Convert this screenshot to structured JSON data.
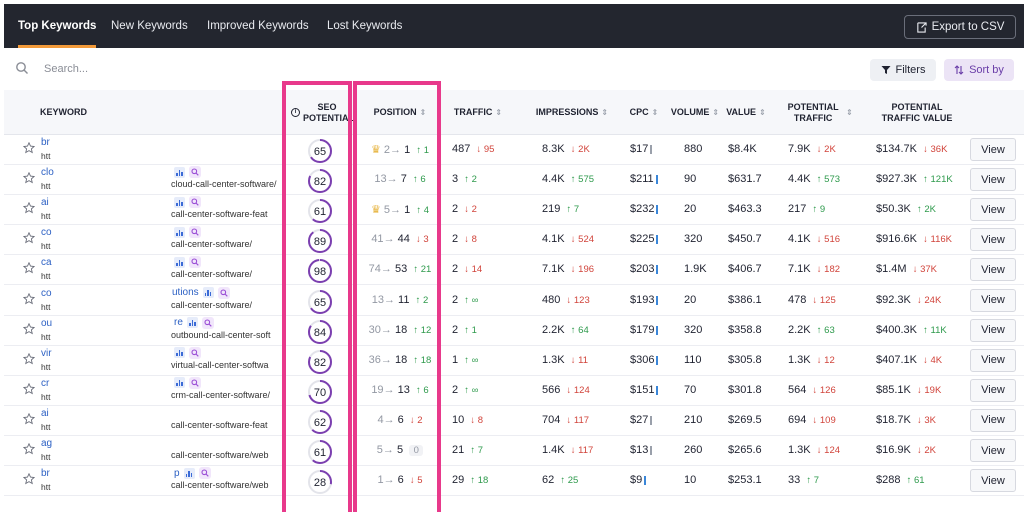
{
  "tabs": [
    {
      "label": "Top Keywords",
      "active": true
    },
    {
      "label": "New Keywords",
      "active": false
    },
    {
      "label": "Improved Keywords",
      "active": false
    },
    {
      "label": "Lost Keywords",
      "active": false
    }
  ],
  "export_label": "Export to CSV",
  "search": {
    "placeholder": "Search..."
  },
  "filters_label": "Filters",
  "sort_label": "Sort by",
  "columns": {
    "keyword": "KEYWORD",
    "seo_potential": "SEO POTENTIAL",
    "position": "POSITION",
    "traffic": "TRAFFIC",
    "impressions": "IMPRESSIONS",
    "cpc": "CPC",
    "volume": "VOLUME",
    "value": "VALUE",
    "potential_traffic": "POTENTIAL TRAFFIC",
    "potential_traffic_value": "POTENTIAL TRAFFIC VALUE"
  },
  "view_label": "View",
  "colors": {
    "highlight": "#e8398b",
    "accent_tab": "#f29a3a",
    "seo_ring": "#7b3fb0",
    "up": "#2e9a4c",
    "down": "#d1443b"
  },
  "rows": [
    {
      "kw": "br",
      "url": "htt",
      "badge_text": "",
      "badges": false,
      "landing": "",
      "seo": 65,
      "crown": true,
      "from": "2",
      "to": "1",
      "pdir": "up",
      "pchg": "1",
      "traffic": "487",
      "tdir": "dn",
      "tchg": "95",
      "impr": "8.3K",
      "idir": "dn",
      "ichg": "2K",
      "cpc": "$17",
      "cpc_color": "#9aa0ab",
      "volume": "880",
      "value": "$8.4K",
      "pt": "7.9K",
      "ptdir": "dn",
      "ptchg": "2K",
      "ptv": "$134.7K",
      "ptvdir": "dn",
      "ptvchg": "36K"
    },
    {
      "kw": "clo",
      "url": "htt",
      "badge_text": "",
      "badges": true,
      "landing": "cloud-call-center-software/",
      "seo": 82,
      "crown": false,
      "from": "13",
      "to": "7",
      "pdir": "up",
      "pchg": "6",
      "traffic": "3",
      "tdir": "up",
      "tchg": "2",
      "impr": "4.4K",
      "idir": "up",
      "ichg": "575",
      "cpc": "$211",
      "cpc_color": "#3a86d8",
      "volume": "90",
      "value": "$631.7",
      "pt": "4.4K",
      "ptdir": "up",
      "ptchg": "573",
      "ptv": "$927.3K",
      "ptvdir": "up",
      "ptvchg": "121K"
    },
    {
      "kw": "ai",
      "url": "htt",
      "badge_text": "",
      "badges": true,
      "landing": "call-center-software-feat",
      "seo": 61,
      "crown": true,
      "from": "5",
      "to": "1",
      "pdir": "up",
      "pchg": "4",
      "traffic": "2",
      "tdir": "dn",
      "tchg": "2",
      "impr": "219",
      "idir": "up",
      "ichg": "7",
      "cpc": "$232",
      "cpc_color": "#3a86d8",
      "volume": "20",
      "value": "$463.3",
      "pt": "217",
      "ptdir": "up",
      "ptchg": "9",
      "ptv": "$50.3K",
      "ptvdir": "up",
      "ptvchg": "2K"
    },
    {
      "kw": "co",
      "url": "htt",
      "badge_text": "",
      "badges": true,
      "landing": "call-center-software/",
      "seo": 89,
      "crown": false,
      "from": "41",
      "to": "44",
      "pdir": "dn",
      "pchg": "3",
      "traffic": "2",
      "tdir": "dn",
      "tchg": "8",
      "impr": "4.1K",
      "idir": "dn",
      "ichg": "524",
      "cpc": "$225",
      "cpc_color": "#3a86d8",
      "volume": "320",
      "value": "$450.7",
      "pt": "4.1K",
      "ptdir": "dn",
      "ptchg": "516",
      "ptv": "$916.6K",
      "ptvdir": "dn",
      "ptvchg": "116K"
    },
    {
      "kw": "ca",
      "url": "htt",
      "badge_text": "",
      "badges": true,
      "landing": "call-center-software/",
      "seo": 98,
      "crown": false,
      "from": "74",
      "to": "53",
      "pdir": "up",
      "pchg": "21",
      "traffic": "2",
      "tdir": "dn",
      "tchg": "14",
      "impr": "7.1K",
      "idir": "dn",
      "ichg": "196",
      "cpc": "$203",
      "cpc_color": "#3a86d8",
      "volume": "1.9K",
      "value": "$406.7",
      "pt": "7.1K",
      "ptdir": "dn",
      "ptchg": "182",
      "ptv": "$1.4M",
      "ptvdir": "dn",
      "ptvchg": "37K"
    },
    {
      "kw": "co",
      "url": "htt",
      "badge_text": "utions",
      "badges": true,
      "landing": "call-center-software/",
      "seo": 65,
      "crown": false,
      "from": "13",
      "to": "11",
      "pdir": "up",
      "pchg": "2",
      "traffic": "2",
      "tdir": "up",
      "tchg": "∞",
      "impr": "480",
      "idir": "dn",
      "ichg": "123",
      "cpc": "$193",
      "cpc_color": "#3a86d8",
      "volume": "20",
      "value": "$386.1",
      "pt": "478",
      "ptdir": "dn",
      "ptchg": "125",
      "ptv": "$92.3K",
      "ptvdir": "dn",
      "ptvchg": "24K"
    },
    {
      "kw": "ou",
      "url": "htt",
      "badge_text": "re",
      "badges": true,
      "landing": "outbound-call-center-soft",
      "seo": 84,
      "crown": false,
      "from": "30",
      "to": "18",
      "pdir": "up",
      "pchg": "12",
      "traffic": "2",
      "tdir": "up",
      "tchg": "1",
      "impr": "2.2K",
      "idir": "up",
      "ichg": "64",
      "cpc": "$179",
      "cpc_color": "#3a86d8",
      "volume": "320",
      "value": "$358.8",
      "pt": "2.2K",
      "ptdir": "up",
      "ptchg": "63",
      "ptv": "$400.3K",
      "ptvdir": "up",
      "ptvchg": "11K"
    },
    {
      "kw": "vir",
      "url": "htt",
      "badge_text": "",
      "badges": true,
      "landing": "virtual-call-center-softwa",
      "seo": 82,
      "crown": false,
      "from": "36",
      "to": "18",
      "pdir": "up",
      "pchg": "18",
      "traffic": "1",
      "tdir": "up",
      "tchg": "∞",
      "impr": "1.3K",
      "idir": "dn",
      "ichg": "11",
      "cpc": "$306",
      "cpc_color": "#3a86d8",
      "volume": "110",
      "value": "$305.8",
      "pt": "1.3K",
      "ptdir": "dn",
      "ptchg": "12",
      "ptv": "$407.1K",
      "ptvdir": "dn",
      "ptvchg": "4K"
    },
    {
      "kw": "cr",
      "url": "htt",
      "badge_text": "",
      "badges": true,
      "landing": "crm-call-center-software/",
      "seo": 70,
      "crown": false,
      "from": "19",
      "to": "13",
      "pdir": "up",
      "pchg": "6",
      "traffic": "2",
      "tdir": "up",
      "tchg": "∞",
      "impr": "566",
      "idir": "dn",
      "ichg": "124",
      "cpc": "$151",
      "cpc_color": "#3a86d8",
      "volume": "70",
      "value": "$301.8",
      "pt": "564",
      "ptdir": "dn",
      "ptchg": "126",
      "ptv": "$85.1K",
      "ptvdir": "dn",
      "ptvchg": "19K"
    },
    {
      "kw": "ai",
      "url": "htt",
      "badge_text": "",
      "badges": false,
      "landing": "call-center-software-feat",
      "seo": 62,
      "crown": false,
      "from": "4",
      "to": "6",
      "pdir": "dn",
      "pchg": "2",
      "traffic": "10",
      "tdir": "dn",
      "tchg": "8",
      "impr": "704",
      "idir": "dn",
      "ichg": "117",
      "cpc": "$27",
      "cpc_color": "#9aa0ab",
      "volume": "210",
      "value": "$269.5",
      "pt": "694",
      "ptdir": "dn",
      "ptchg": "109",
      "ptv": "$18.7K",
      "ptvdir": "dn",
      "ptvchg": "3K"
    },
    {
      "kw": "ag",
      "url": "htt",
      "badge_text": "",
      "badges": false,
      "landing": "call-center-software/web",
      "seo": 61,
      "crown": false,
      "from": "5",
      "to": "5",
      "pdir": "zero",
      "pchg": "0",
      "traffic": "21",
      "tdir": "up",
      "tchg": "7",
      "impr": "1.4K",
      "idir": "dn",
      "ichg": "117",
      "cpc": "$13",
      "cpc_color": "#9aa0ab",
      "volume": "260",
      "value": "$265.6",
      "pt": "1.3K",
      "ptdir": "dn",
      "ptchg": "124",
      "ptv": "$16.9K",
      "ptvdir": "dn",
      "ptvchg": "2K"
    },
    {
      "kw": "br",
      "url": "htt",
      "badge_text": "p",
      "badges": true,
      "landing": "call-center-software/web",
      "seo": 28,
      "crown": false,
      "from": "1",
      "to": "6",
      "pdir": "dn",
      "pchg": "5",
      "traffic": "29",
      "tdir": "up",
      "tchg": "18",
      "impr": "62",
      "idir": "up",
      "ichg": "25",
      "cpc": "$9",
      "cpc_color": "#3a86d8",
      "volume": "10",
      "value": "$253.1",
      "pt": "33",
      "ptdir": "up",
      "ptchg": "7",
      "ptv": "$288",
      "ptvdir": "up",
      "ptvchg": "61"
    }
  ]
}
